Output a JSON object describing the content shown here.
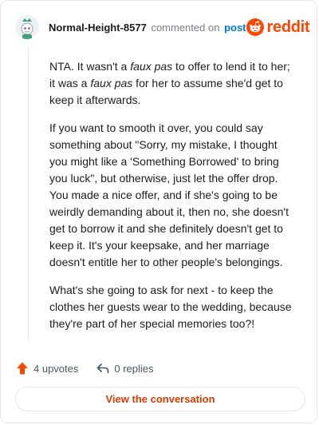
{
  "header": {
    "username": "Normal-Height-8577",
    "commented_text": "commented on",
    "post_link": "post",
    "logo_text": "reddit"
  },
  "comment": {
    "p1_a": "NTA. It wasn't a ",
    "p1_em1": "faux pas",
    "p1_b": " to offer to lend it to her; it was a ",
    "p1_em2": "faux pas",
    "p1_c": " for her to assume she'd get to keep it afterwards.",
    "p2": "If you want to smooth it over, you could say something about \"Sorry, my mistake, I thought you might like a 'Something Borrowed' to bring you luck\", but otherwise, just let the offer drop. You made a nice offer, and if she's going to be weirdly demanding about it, then no, she doesn't get to borrow it and she definitely doesn't get to keep it. It's your keepsake, and her marriage doesn't entitle her to other people's belongings.",
    "p3": "What's she going to ask for next - to keep the clothes her guests wear to the wedding, because they're part of her special memories too?!"
  },
  "actions": {
    "upvotes": "4 upvotes",
    "replies": "0 replies"
  },
  "cta": {
    "label": "View the conversation"
  },
  "colors": {
    "brand": "#ff4500",
    "link": "#0079d3",
    "cta_text": "#d93a00",
    "upvote": "#ff4500"
  },
  "icons": {
    "avatar": "snoo-avatar-icon",
    "logo": "reddit-logo-icon",
    "upvote": "upvote-arrow-icon",
    "reply": "reply-arrow-icon"
  }
}
